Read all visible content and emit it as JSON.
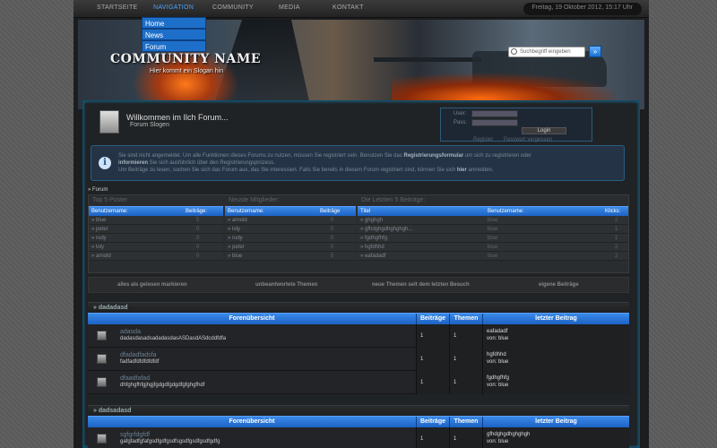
{
  "topnav": {
    "items": [
      "STARTSEITE",
      "NAVIGATION",
      "COMMUNITY",
      "MEDIA",
      "KONTAKT"
    ],
    "date": "Freitag, 19 Oktober 2012, 15:17 Uhr"
  },
  "dropdown": {
    "items": [
      "Home",
      "News",
      "Forum"
    ]
  },
  "header": {
    "title": "COMMUNITY NAME",
    "slogan": "Hier kommt ein Slogan hin",
    "search_placeholder": "Suchbegriff eingeben",
    "search_button": "»"
  },
  "welcome": {
    "title": "Willkommen im Ilch Forum...",
    "subtitle": "Forum Slogen"
  },
  "login": {
    "user_label": "User:",
    "pass_label": "Pass:",
    "button": "Login",
    "register": "Register",
    "forgot": "Passwort vergessen"
  },
  "notice": {
    "icon": "info-icon",
    "line1_a": "Sie sind nicht angemeldet. Um alle Funktionen dieses Forums zu nutzen, müssen Sie registriert sein. Benutzen Sie das ",
    "line1_b": "Registrierungsformular",
    "line1_c": " um sich zu registrieren oder ",
    "line2_a": "informieren",
    "line2_b": " Sie sich ausführlich über den Registrierungsprozess.",
    "line3_a": "Um Beiträge zu lesen, suchen Sie sich das Forum aus, das Sie interessiert. Falls Sie bereits in diesem Forum registriert sind, können Sie sich ",
    "line3_b": "hier",
    "line3_c": " anmelden."
  },
  "breadcrumb": "» Forum",
  "stats": {
    "top_poster": {
      "title": "Top 5 Poster",
      "col1": "Benutzername:",
      "col2": "Beiträge:",
      "rows": [
        {
          "name": "» blue",
          "val": "5"
        },
        {
          "name": "» peter",
          "val": "0"
        },
        {
          "name": "» rudy",
          "val": "0"
        },
        {
          "name": "» loly",
          "val": "0"
        },
        {
          "name": "» arnold",
          "val": "0"
        }
      ]
    },
    "new_members": {
      "title": "Neuste Mitglieder:",
      "col1": "Benutzername:",
      "col2": "Beiträge",
      "rows": [
        {
          "name": "» arnold",
          "val": "0"
        },
        {
          "name": "» loly",
          "val": "0"
        },
        {
          "name": "» rudy",
          "val": "0"
        },
        {
          "name": "» peter",
          "val": "0"
        },
        {
          "name": "» blue",
          "val": "5"
        }
      ]
    },
    "latest_posts": {
      "title": "Die Letzten 5 Beiträge:",
      "col1": "Titel",
      "col2": "Benutzername:",
      "col3": "Klicks:",
      "rows": [
        {
          "title": "» ghghgh",
          "user": "blue",
          "clicks": "2"
        },
        {
          "title": "» gfhdghgdhghghgh...",
          "user": "blue",
          "clicks": "1"
        },
        {
          "title": "» fgdhgfhfg",
          "user": "blue",
          "clicks": "1"
        },
        {
          "title": "» hgfdhhd",
          "user": "blue",
          "clicks": "2"
        },
        {
          "title": "» eafadadf",
          "user": "blue",
          "clicks": "2"
        }
      ]
    }
  },
  "actions": [
    "alles als gelesen markieren",
    "unbeantwortete Themen",
    "neue Themen seit dem letzten Besuch",
    "eigene Beiträge"
  ],
  "table_head": {
    "forum": "Forenübersicht",
    "posts": "Beiträge",
    "topics": "Themen",
    "last": "letzter Beitrag"
  },
  "categories": [
    {
      "title": "» dadadasd",
      "forums": [
        {
          "name": "adasda",
          "desc": "dadasdasadsadadasdasASDasdASdcddfdfa",
          "posts": "1",
          "topics": "1",
          "last_title": "eafadadf",
          "last_by": "von: blue"
        },
        {
          "name": "dfadadfadsfa",
          "desc": "fadfadfdfdfdfdfdf",
          "posts": "1",
          "topics": "1",
          "last_title": "hgfdhhd",
          "last_by": "von: blue"
        },
        {
          "name": "dfaadfafad",
          "desc": "dhfghgfhfgjhgjfgdgdfgdgdfgfghgfhdf",
          "posts": "1",
          "topics": "1",
          "last_title": "fgdhgfhfg",
          "last_by": "von: blue"
        }
      ]
    },
    {
      "title": "» dadsadasd",
      "forums": [
        {
          "name": "sgfgrfdgfdf",
          "desc": "gafgfadfgfafgsdfgdfgsdfsgsdfgsdfgsdfgdfg",
          "posts": "1",
          "topics": "1",
          "last_title": "gfhdghgdhghghgh",
          "last_by": "von: blue"
        }
      ]
    }
  ],
  "colors": {
    "accent": "#1e6fc9",
    "header_blue": "#3a8ae8",
    "background": "#1b1d1f"
  }
}
